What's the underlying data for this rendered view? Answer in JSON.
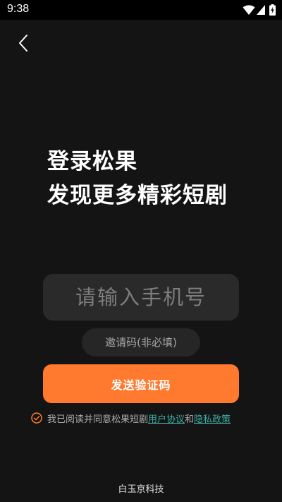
{
  "status_bar": {
    "time": "9:38",
    "icons": [
      "wifi-icon",
      "cellular-signal-icon",
      "battery-charging-icon"
    ]
  },
  "nav": {
    "back_icon": "chevron-left-icon"
  },
  "heading": {
    "line1": "登录松果",
    "line2": "发现更多精彩短剧"
  },
  "phone_input": {
    "placeholder": "请输入手机号",
    "value": ""
  },
  "invite_input": {
    "placeholder": "邀请码(非必填)",
    "value": ""
  },
  "send_button": {
    "label": "发送验证码"
  },
  "agreement": {
    "checked": true,
    "prefix": "我已阅读并同意松果短剧",
    "user_agreement": "用户协议",
    "connector": "和",
    "privacy_policy": "隐私政策"
  },
  "footer": {
    "company": "白玉京科技"
  },
  "colors": {
    "accent": "#ff7a2e",
    "link": "#3cb0a5",
    "background": "#141414",
    "input_bg": "#2a2a2a"
  }
}
